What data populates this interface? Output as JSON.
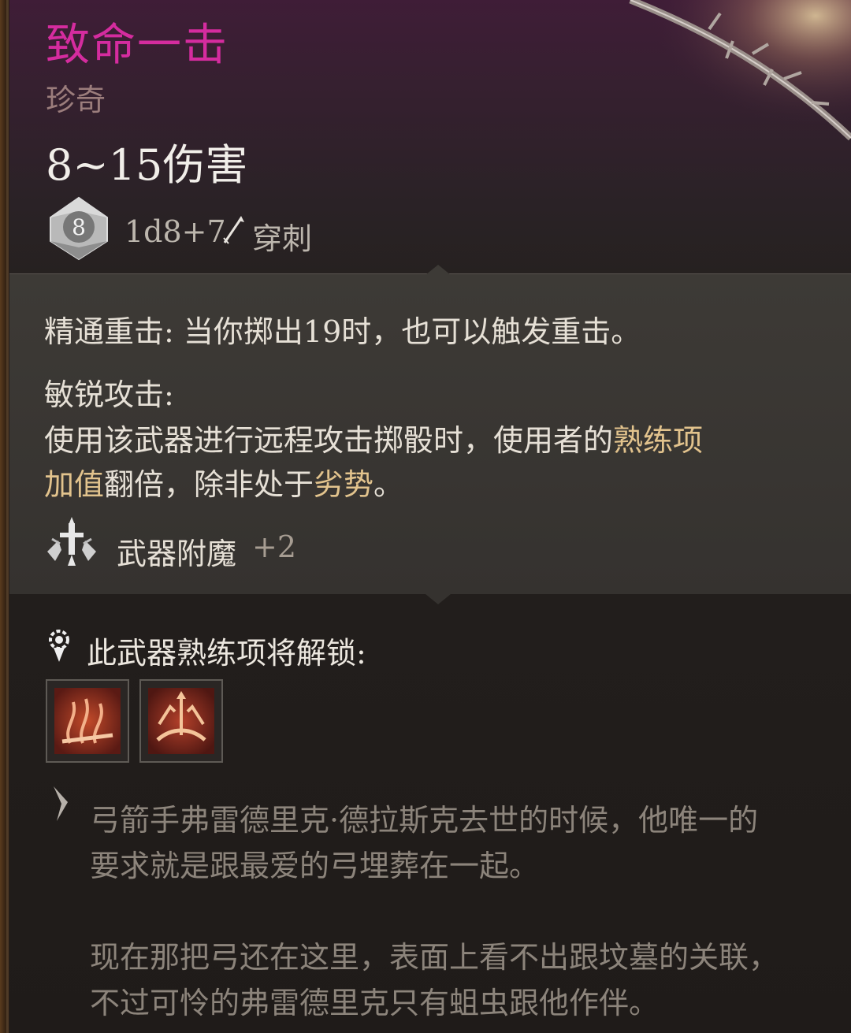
{
  "item": {
    "name": "致命一击",
    "rarity": "珍奇",
    "damage": "8~15伤害",
    "dice": {
      "die_face": "8",
      "formula": "1d8+7",
      "damage_type": "穿刺"
    },
    "passives": [
      {
        "name": "精通重击:",
        "text": "当你掷出19时，也可以触发重击。"
      },
      {
        "name": "敏锐攻击:",
        "line1_prefix": "使用该武器进行远程攻击掷骰时，使用者的",
        "line1_highlight": "熟练项",
        "line2_highlight": "加值",
        "line2_middle": "翻倍，除非处于",
        "line2_highlight2": "劣势",
        "line2_suffix": "。"
      }
    ],
    "enchantment": {
      "label": "武器附魔",
      "value": "+2"
    },
    "proficiency": {
      "title": "此武器熟练项将解锁:",
      "skills": [
        {
          "name": "skill-1",
          "icon": "flame-boot-icon"
        },
        {
          "name": "skill-2",
          "icon": "bow-arrow-icon"
        }
      ]
    },
    "flavor": [
      "弓箭手弗雷德里克·德拉斯克去世的时候，他唯一的",
      "要求就是跟最爱的弓埋葬在一起。",
      "现在那把弓还在这里，表面上看不出跟坟墓的关联，",
      "不过可怜的弗雷德里克只有蛆虫跟他作伴。"
    ]
  },
  "colors": {
    "title": "#d52c9f",
    "highlight": "#e2c38d",
    "flavor": "#8c847b"
  }
}
